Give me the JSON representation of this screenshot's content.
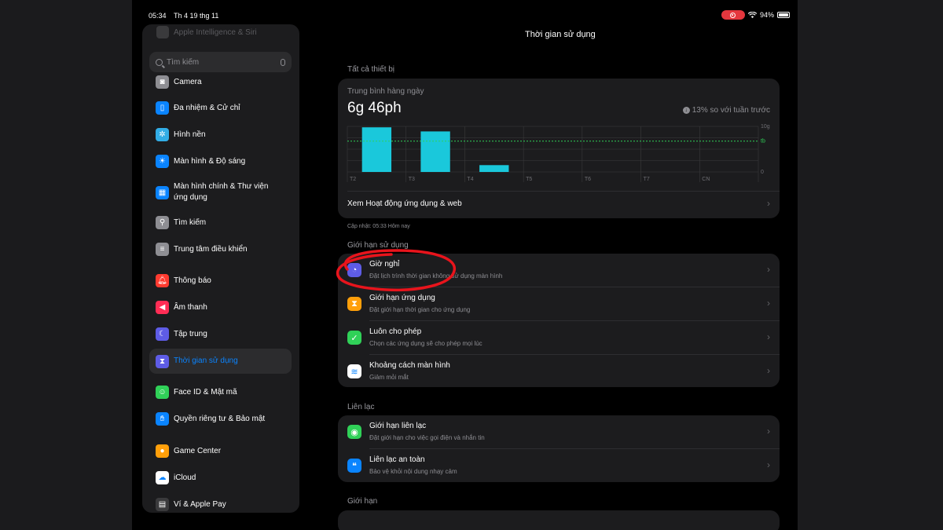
{
  "status_bar": {
    "time": "05:34",
    "date": "Th 4 19 thg 11",
    "battery": "94%"
  },
  "sidebar": {
    "faded_item": "Apple Intelligence & Siri",
    "search_placeholder": "Tìm kiếm",
    "items": [
      {
        "label": "Camera",
        "icon": "camera-icon",
        "color": "#8e8e93"
      },
      {
        "label": "Đa nhiệm & Cử chỉ",
        "icon": "multitasking-icon",
        "color": "#0a84ff"
      },
      {
        "label": "Hình nền",
        "icon": "wallpaper-icon",
        "color": "#32ade6"
      },
      {
        "label": "Màn hình & Độ sáng",
        "icon": "brightness-icon",
        "color": "#0a84ff"
      },
      {
        "label": "Màn hình chính & Thư viện ứng dụng",
        "icon": "home-screen-icon",
        "color": "#0a84ff"
      },
      {
        "label": "Tìm kiếm",
        "icon": "search-icon",
        "color": "#8e8e93"
      },
      {
        "label": "Trung tâm điều khiển",
        "icon": "control-center-icon",
        "color": "#8e8e93"
      },
      {
        "label": "Thông báo",
        "icon": "bell-icon",
        "color": "#ff3b30"
      },
      {
        "label": "Âm thanh",
        "icon": "speaker-icon",
        "color": "#ff2d55"
      },
      {
        "label": "Tập trung",
        "icon": "moon-icon",
        "color": "#5e5ce6"
      },
      {
        "label": "Thời gian sử dụng",
        "icon": "hourglass-icon",
        "color": "#5e5ce6"
      },
      {
        "label": "Face ID & Mật mã",
        "icon": "face-id-icon",
        "color": "#30d158"
      },
      {
        "label": "Quyền riêng tư & Bảo mật",
        "icon": "hand-icon",
        "color": "#0a84ff"
      },
      {
        "label": "Game Center",
        "icon": "game-center-icon",
        "color": "#ff9f0a"
      },
      {
        "label": "iCloud",
        "icon": "cloud-icon",
        "color": "#ffffff"
      },
      {
        "label": "Ví & Apple Pay",
        "icon": "wallet-icon",
        "color": "#3a3a3c"
      }
    ]
  },
  "main": {
    "title": "Thời gian sử dụng",
    "all_devices_header": "Tất cả thiết bị",
    "daily_average_label": "Trung bình hàng ngày",
    "daily_average_value": "6g 46ph",
    "delta_text": "13% so với tuần trước",
    "view_activity": "Xem Hoạt động ứng dụng & web",
    "updated_note": "Cập nhật: 05:33 Hôm nay",
    "limits_header": "Giới hạn sử dụng",
    "limits_rows": [
      {
        "title": "Giờ nghỉ",
        "subtitle": "Đặt lịch trình thời gian không sử dụng màn hình",
        "icon": "downtime-icon",
        "color": "#5e5ce6"
      },
      {
        "title": "Giới hạn ứng dụng",
        "subtitle": "Đặt giới hạn thời gian cho ứng dụng",
        "icon": "hourglass-icon",
        "color": "#ff9f0a"
      },
      {
        "title": "Luôn cho phép",
        "subtitle": "Chọn các ứng dụng sẽ cho phép mọi lúc",
        "icon": "checkmark-icon",
        "color": "#30d158"
      },
      {
        "title": "Khoảng cách màn hình",
        "subtitle": "Giảm mỏi mắt",
        "icon": "screen-distance-icon",
        "color": "#ffffff"
      }
    ],
    "communication_header": "Liên lạc",
    "communication_rows": [
      {
        "title": "Giới hạn liên lạc",
        "subtitle": "Đặt giới hạn cho việc gọi điện và nhắn tin",
        "icon": "contact-icon",
        "color": "#30d158"
      },
      {
        "title": "Liên lạc an toàn",
        "subtitle": "Bảo vệ khỏi nội dung nhạy cảm",
        "icon": "chat-icon",
        "color": "#0a84ff"
      }
    ],
    "restrictions_header": "Giới hạn"
  },
  "chart_data": {
    "type": "bar",
    "categories": [
      "T2",
      "T3",
      "T4",
      "T5",
      "T6",
      "T7",
      "CN"
    ],
    "values": [
      9.8,
      8.9,
      1.5,
      0,
      0,
      0,
      0
    ],
    "ytick_labels": [
      "10g",
      "tb",
      "0"
    ],
    "ylim": [
      0,
      10
    ],
    "average": 6.77,
    "bar_color": "#1ac8db",
    "average_line_color": "#30d158"
  }
}
